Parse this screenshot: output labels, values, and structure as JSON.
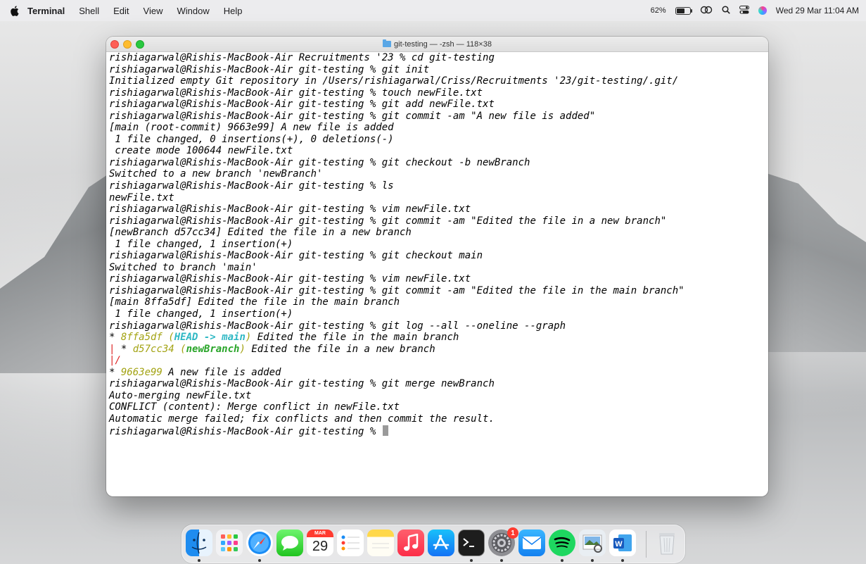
{
  "menubar": {
    "app_name": "Terminal",
    "menus": [
      "Shell",
      "Edit",
      "View",
      "Window",
      "Help"
    ],
    "battery_percent": "62%",
    "battery_level": 0.62,
    "datetime": "Wed 29 Mar  11:04 AM",
    "status_icons": [
      "link-icon",
      "search-icon",
      "control-center-icon",
      "siri-icon"
    ]
  },
  "window": {
    "title": "git-testing — -zsh — 118×38"
  },
  "terminal": {
    "prompt_dir_start": "rishiagarwal@Rishis-MacBook-Air Recruitments '23 % ",
    "prompt": "rishiagarwal@Rishis-MacBook-Air git-testing % ",
    "lines": [
      "rishiagarwal@Rishis-MacBook-Air Recruitments '23 % cd git-testing",
      "rishiagarwal@Rishis-MacBook-Air git-testing % git init",
      "Initialized empty Git repository in /Users/rishiagarwal/Criss/Recruitments '23/git-testing/.git/",
      "rishiagarwal@Rishis-MacBook-Air git-testing % touch newFile.txt",
      "rishiagarwal@Rishis-MacBook-Air git-testing % git add newFile.txt",
      "rishiagarwal@Rishis-MacBook-Air git-testing % git commit -am \"A new file is added\"",
      "[main (root-commit) 9663e99] A new file is added",
      " 1 file changed, 0 insertions(+), 0 deletions(-)",
      " create mode 100644 newFile.txt",
      "rishiagarwal@Rishis-MacBook-Air git-testing % git checkout -b newBranch",
      "Switched to a new branch 'newBranch'",
      "rishiagarwal@Rishis-MacBook-Air git-testing % ls",
      "newFile.txt",
      "rishiagarwal@Rishis-MacBook-Air git-testing % vim newFile.txt",
      "rishiagarwal@Rishis-MacBook-Air git-testing % git commit -am \"Edited the file in a new branch\"",
      "[newBranch d57cc34] Edited the file in a new branch",
      " 1 file changed, 1 insertion(+)",
      "rishiagarwal@Rishis-MacBook-Air git-testing % git checkout main",
      "Switched to branch 'main'",
      "rishiagarwal@Rishis-MacBook-Air git-testing % vim newFile.txt",
      "rishiagarwal@Rishis-MacBook-Air git-testing % git commit -am \"Edited the file in the main branch\"",
      "[main 8ffa5df] Edited the file in the main branch",
      " 1 file changed, 1 insertion(+)",
      "rishiagarwal@Rishis-MacBook-Air git-testing % git log --all --oneline --graph"
    ],
    "graph": {
      "g1": {
        "marker": "* ",
        "hash": "8ffa5df",
        "open": " (",
        "head": "HEAD -> main",
        "close": ")",
        "msg": " Edited the file in the main branch"
      },
      "g2": {
        "pipe": "|",
        "marker": " * ",
        "hash": "d57cc34",
        "open": " (",
        "branch": "newBranch",
        "close": ")",
        "msg": " Edited the file in a new branch"
      },
      "g3": {
        "text": "|/"
      },
      "g4": {
        "marker": "* ",
        "hash": "9663e99",
        "msg": " A new file is added"
      }
    },
    "after_lines": [
      "rishiagarwal@Rishis-MacBook-Air git-testing % git merge newBranch",
      "Auto-merging newFile.txt",
      "CONFLICT (content): Merge conflict in newFile.txt",
      "Automatic merge failed; fix conflicts and then commit the result."
    ]
  },
  "dock": {
    "apps": [
      {
        "name": "Finder",
        "icon": "finder-icon"
      },
      {
        "name": "Launchpad",
        "icon": "launchpad-icon"
      },
      {
        "name": "Safari",
        "icon": "safari-icon"
      },
      {
        "name": "Messages",
        "icon": "messages-icon"
      },
      {
        "name": "Calendar",
        "icon": "calendar-icon"
      },
      {
        "name": "Reminders",
        "icon": "reminders-icon"
      },
      {
        "name": "Notes",
        "icon": "notes-icon"
      },
      {
        "name": "Music",
        "icon": "music-icon"
      },
      {
        "name": "App Store",
        "icon": "app-store-icon"
      },
      {
        "name": "Terminal",
        "icon": "terminal-icon"
      },
      {
        "name": "System Settings",
        "icon": "settings-icon"
      },
      {
        "name": "Mail",
        "icon": "mail-icon"
      },
      {
        "name": "Spotify",
        "icon": "spotify-icon"
      },
      {
        "name": "Preview",
        "icon": "preview-icon"
      },
      {
        "name": "Microsoft Word",
        "icon": "word-icon"
      },
      {
        "name": "Trash",
        "icon": "trash-icon"
      }
    ],
    "calendar_month": "MAR",
    "calendar_day": "29",
    "settings_badge": "1"
  },
  "colors": {
    "graph_hash": "#a3a313",
    "graph_head": "#2fb8c4",
    "graph_branch": "#2aa52a",
    "graph_pipe": "#dd2222"
  }
}
